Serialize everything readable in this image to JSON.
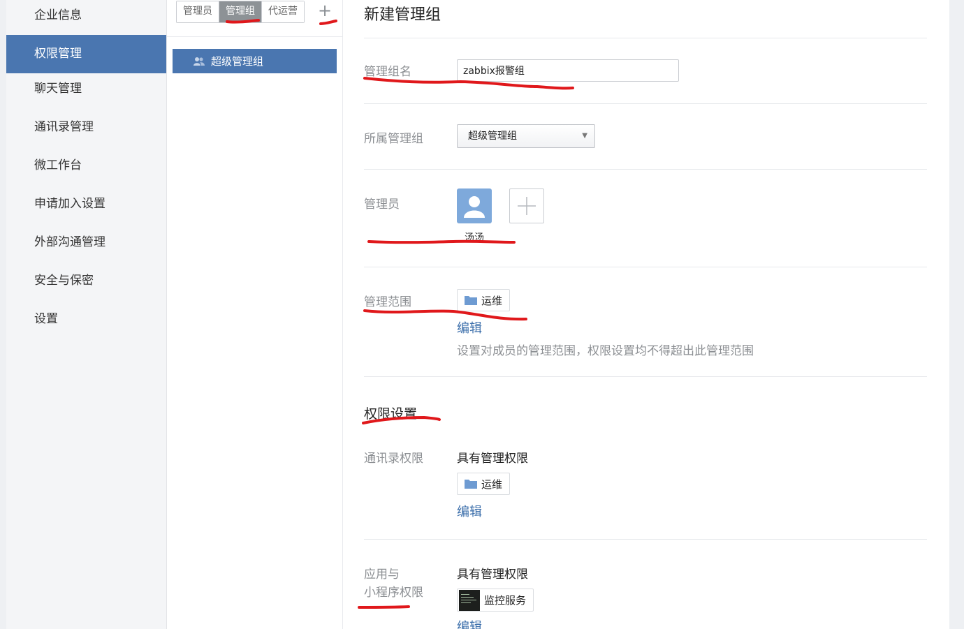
{
  "nav": {
    "items": [
      {
        "label": "企业信息",
        "active": false
      },
      {
        "label": "权限管理",
        "active": true
      },
      {
        "label": "聊天管理",
        "active": false
      },
      {
        "label": "通讯录管理",
        "active": false
      },
      {
        "label": "微工作台",
        "active": false
      },
      {
        "label": "申请加入设置",
        "active": false
      },
      {
        "label": "外部沟通管理",
        "active": false
      },
      {
        "label": "安全与保密",
        "active": false
      },
      {
        "label": "设置",
        "active": false
      }
    ]
  },
  "mid": {
    "tabs": [
      {
        "label": "管理员",
        "active": false
      },
      {
        "label": "管理组",
        "active": true
      },
      {
        "label": "代运营",
        "active": false
      }
    ],
    "add_label": "+",
    "groups": [
      {
        "label": "超级管理组",
        "icon": "users-icon"
      }
    ]
  },
  "form": {
    "title": "新建管理组",
    "group_name": {
      "label": "管理组名",
      "value": "zabbix报警组"
    },
    "parent_group": {
      "label": "所属管理组",
      "value": "超级管理组"
    },
    "admins": {
      "label": "管理员",
      "members": [
        {
          "name": "汤汤",
          "icon": "user-avatar-icon"
        }
      ]
    },
    "scope": {
      "label": "管理范围",
      "departments": [
        {
          "name": "运维",
          "icon": "folder-icon"
        }
      ],
      "edit_label": "编辑",
      "hint": "设置对成员的管理范围，权限设置均不得超出此管理范围"
    }
  },
  "permissions": {
    "title": "权限设置",
    "contacts": {
      "label": "通讯录权限",
      "level": "具有管理权限",
      "departments": [
        {
          "name": "运维",
          "icon": "folder-icon"
        }
      ],
      "edit_label": "编辑"
    },
    "apps": {
      "label_line1": "应用与",
      "label_line2": "小程序权限",
      "level": "具有管理权限",
      "apps": [
        {
          "name": "监控服务",
          "icon": "terminal-app-icon"
        }
      ],
      "edit_label": "编辑"
    }
  },
  "colors": {
    "accent": "#4a76b0",
    "link": "#3c6fab",
    "annotation": "#e0181b"
  }
}
